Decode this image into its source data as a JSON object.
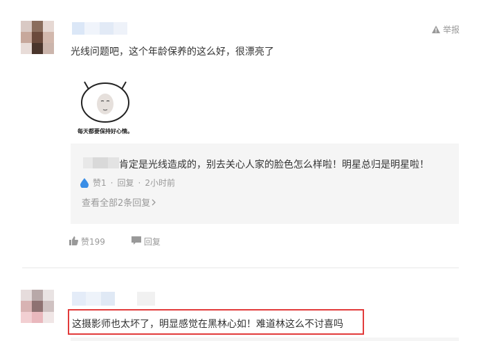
{
  "comment1": {
    "report_label": "举报",
    "text": "光线问题吧，这个年龄保养的这么好，很漂亮了",
    "sticker_caption": "每天都要保持好心情。",
    "reply": {
      "text": "肯定是光线造成的，别去关心人家的脸色怎么样啦！明星总归是明星啦！",
      "likes": "赞1",
      "reply_label": "回复",
      "time": "2小时前",
      "view_all": "查看全部2条回复"
    },
    "like_label": "赞199",
    "reply_label": "回复"
  },
  "comment2": {
    "text": "这摄影师也太坏了，明显感觉在黑林心如！难道林这么不讨喜吗"
  },
  "colors": {
    "highlight_border": "#e23a3a",
    "reply_bg": "#f5f5f5",
    "meta_gray": "#999999",
    "like_drop_blue": "#3a8ee6"
  },
  "icons": {
    "report": "warning-triangle-icon",
    "like_drop": "water-drop-icon",
    "thumb": "thumbs-up-icon",
    "reply": "speech-bubble-icon",
    "chevron": "chevron-right-icon"
  }
}
